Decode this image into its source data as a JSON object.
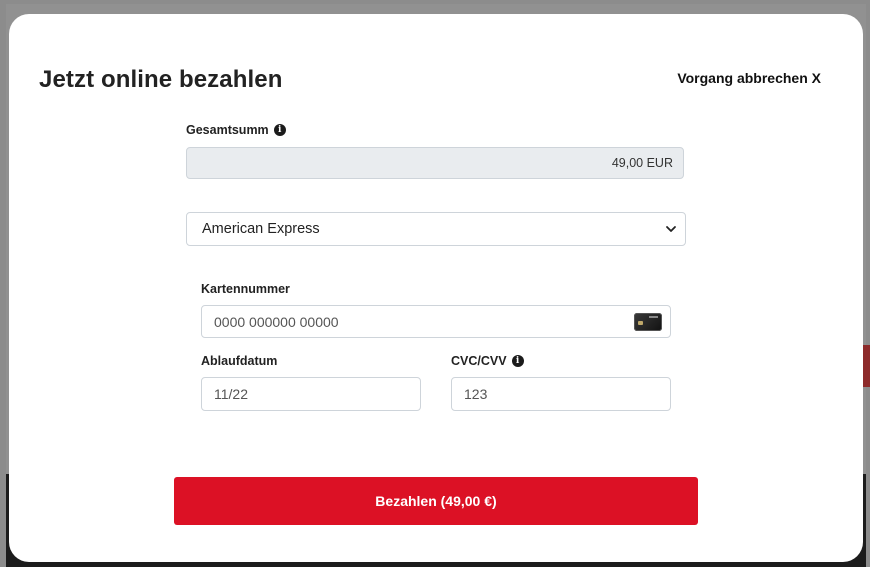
{
  "modal": {
    "title": "Jetzt online bezahlen",
    "cancel_label": "Vorgang abbrechen X"
  },
  "total": {
    "label": "Gesamtsumm",
    "value": "49,00 EUR",
    "info_icon": "info-circle-icon"
  },
  "payment_method": {
    "selected": "American Express",
    "icon": "chevron-down-icon"
  },
  "card_number": {
    "label": "Kartennummer",
    "placeholder": "0000 000000 00000",
    "icon": "credit-card-icon"
  },
  "expiry": {
    "label": "Ablaufdatum",
    "placeholder": "11/22"
  },
  "cvc": {
    "label": "CVC/CVV",
    "placeholder": "123",
    "info_icon": "info-circle-icon"
  },
  "pay_button": {
    "label": "Bezahlen (49,00 €)"
  },
  "colors": {
    "accent": "#dc1125",
    "readonly_bg": "#e9ecef",
    "border": "#ced4da"
  }
}
